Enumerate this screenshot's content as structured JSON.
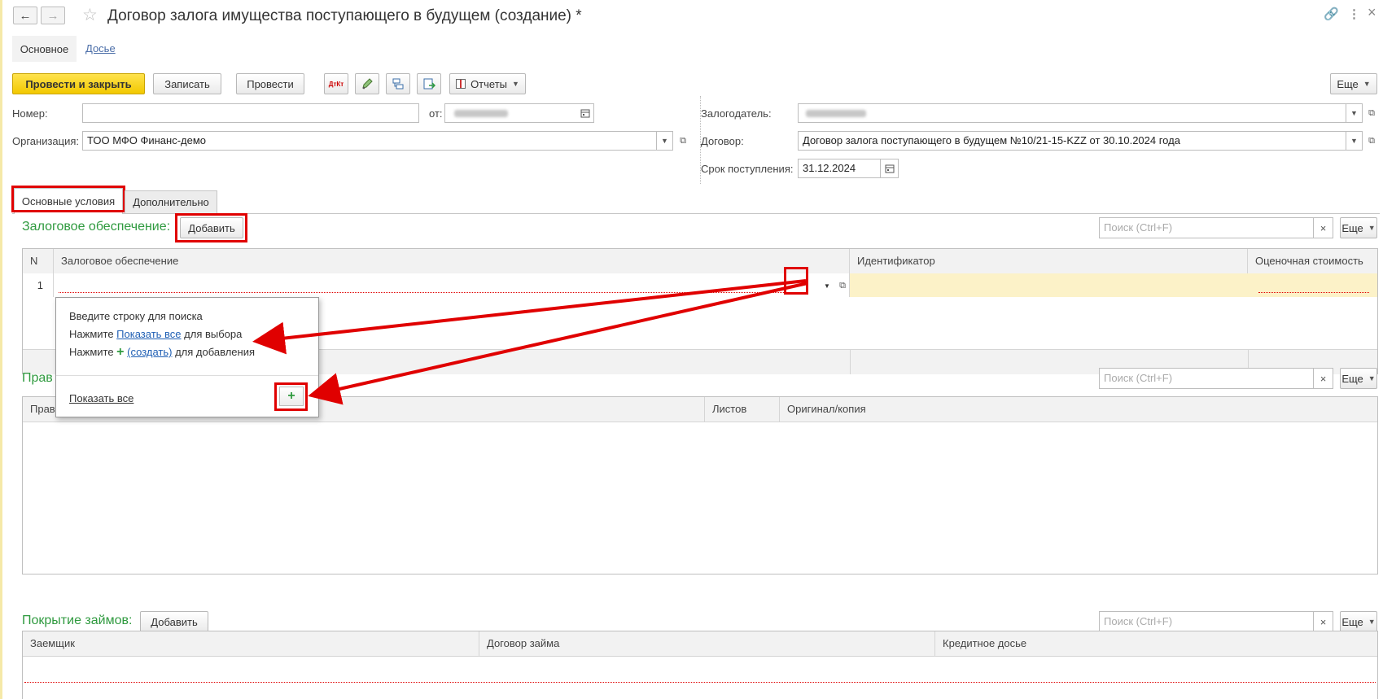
{
  "window": {
    "title": "Договор залога имущества поступающего в будущем (создание) *",
    "nav_back": "←",
    "nav_forward": "→",
    "favorite_icon": "☆",
    "link_icon": "🔗",
    "more_icon": "⋮",
    "close_icon": "×"
  },
  "top_tabs": {
    "main": "Основное",
    "dossier": "Досье"
  },
  "toolbar": {
    "post_close": "Провести и закрыть",
    "save": "Записать",
    "post": "Провести",
    "dt_kt_icon": "ДтКт",
    "reports": "Отчеты",
    "more": "Еще"
  },
  "form": {
    "number_label": "Номер:",
    "number_value": "",
    "date_label": "от:",
    "org_label": "Организация:",
    "org_value": "ТОО МФО Финанс-демо",
    "pledger_label": "Залогодатель:",
    "contract_label": "Договор:",
    "contract_value": "Договор залога поступающего в будущем №10/21-15-KZZ от 30.10.2024 года",
    "receipt_label": "Срок поступления:",
    "receipt_value": "31.12.2024"
  },
  "tabs": {
    "main_conditions": "Основные условия",
    "additional": "Дополнительно"
  },
  "collateral": {
    "title": "Залоговое обеспечение:",
    "add": "Добавить",
    "search_placeholder": "Поиск (Ctrl+F)",
    "more": "Еще",
    "columns": [
      "N",
      "Залоговое обеспечение",
      "Идентификатор",
      "Оценочная стоимость"
    ],
    "row_n": "1"
  },
  "popup": {
    "line1": "Введите строку для поиска",
    "line2_pre": "Нажмите ",
    "line2_link": "Показать все",
    "line2_post": " для выбора",
    "line3_pre": "Нажмите ",
    "line3_link": "(создать)",
    "line3_post": " для добавления",
    "show_all": "Показать все",
    "plus": "+"
  },
  "title_docs": {
    "title_partial": "Прав",
    "search_placeholder": "Поиск (Ctrl+F)",
    "more": "Еще",
    "columns": [
      "Правоустанавливающий документ",
      "Листов",
      "Оригинал/копия"
    ]
  },
  "loans": {
    "title": "Покрытие займов:",
    "add": "Добавить",
    "search_placeholder": "Поиск (Ctrl+F)",
    "more": "Еще",
    "columns": [
      "Заемщик",
      "Договор займа",
      "Кредитное досье"
    ]
  },
  "colors": {
    "accent_yellow": "#f2c800",
    "group_green": "#2f9a3f",
    "annotation_red": "#e00000",
    "selected_row": "#fcf2c8"
  }
}
